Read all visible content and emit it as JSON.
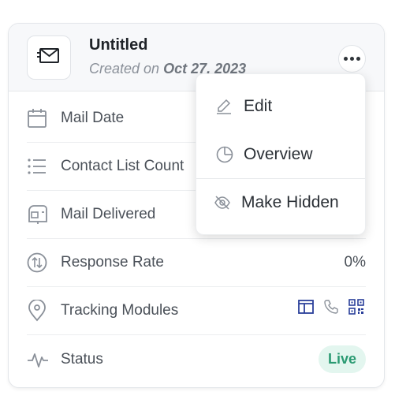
{
  "header": {
    "title": "Untitled",
    "subtitle_prefix": "Created on",
    "subtitle_date": "Oct 27, 2023"
  },
  "rows": [
    {
      "label": "Mail Date",
      "value": "",
      "icon": "calendar-icon"
    },
    {
      "label": "Contact List Count",
      "value": "",
      "icon": "list-icon"
    },
    {
      "label": "Mail Delivered",
      "value": "",
      "icon": "mailbox-icon"
    },
    {
      "label": "Response Rate",
      "value": "0%",
      "icon": "arrows-swap-icon"
    },
    {
      "label": "Tracking Modules",
      "value": "",
      "icon": "location-pin-icon"
    },
    {
      "label": "Status",
      "value": "Live",
      "icon": "activity-icon"
    }
  ],
  "tracking_modules": [
    "landing-page-icon",
    "phone-icon",
    "qr-code-icon"
  ],
  "menu": {
    "items": [
      {
        "label": "Edit",
        "icon": "pencil-icon"
      },
      {
        "label": "Overview",
        "icon": "pie-chart-icon"
      },
      {
        "label": "Make Hidden",
        "icon": "eye-off-icon"
      }
    ]
  },
  "colors": {
    "accent": "#2a3f9a",
    "live_text": "#2a9a72",
    "live_bg": "#e3f6ef",
    "icon_gray": "#8a9099"
  }
}
